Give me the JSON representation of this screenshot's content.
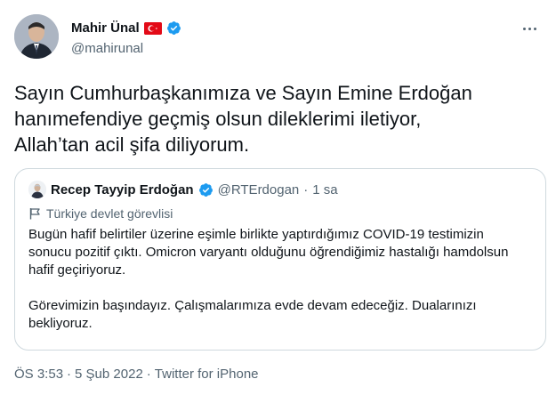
{
  "author": {
    "name": "Mahir Ünal",
    "handle": "@mahirunal"
  },
  "tweet": {
    "text": "Sayın Cumhurbaşkanımıza ve Sayın Emine Erdoğan\nhanımefendiye geçmiş olsun dileklerimi iletiyor,\nAllah’tan acil şifa diliyorum."
  },
  "quote": {
    "name": "Recep Tayyip Erdoğan",
    "handle": "@RTErdogan",
    "separator": "·",
    "time": "1 sa",
    "label": "Türkiye devlet görevlisi",
    "text": "Bugün hafif belirtiler üzerine eşimle birlikte yaptırdığımız COVID-19 testimizin\nsonucu pozitif çıktı. Omicron varyantı olduğunu öğrendiğimiz hastalığı hamdolsun\nhafif geçiriyoruz.\n\nGörevimizin başındayız. Çalışmalarımıza evde devam edeceğiz. Dualarınızı\nbekliyoruz."
  },
  "footer": {
    "time": "ÖS 3:53",
    "dot1": "·",
    "date": "5 Şub 2022",
    "dot2": "·",
    "source": "Twitter for iPhone"
  },
  "colors": {
    "verified": "#1d9bf0",
    "flag": "#e30a17",
    "secondary_text": "#536471"
  },
  "icons": [
    "verified-badge-icon",
    "turkey-flag-icon",
    "more-options-icon",
    "government-flag-icon"
  ]
}
